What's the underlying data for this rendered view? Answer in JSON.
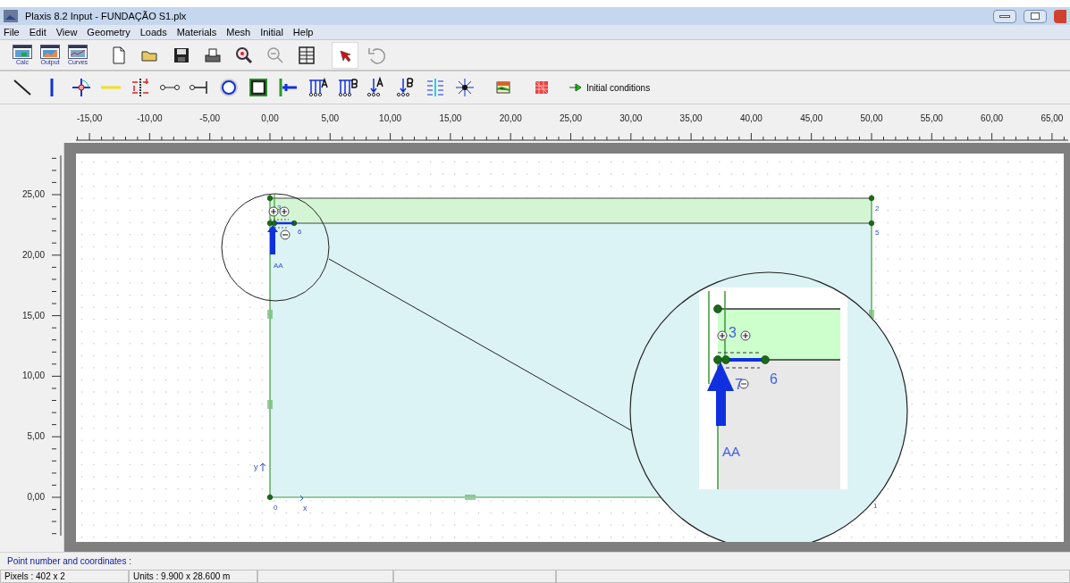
{
  "window": {
    "title": "Plaxis 8.2 Input - FUNDAÇÃO S1.plx"
  },
  "menu": [
    "File",
    "Edit",
    "View",
    "Geometry",
    "Loads",
    "Materials",
    "Mesh",
    "Initial",
    "Help"
  ],
  "programs": [
    {
      "kind": "calc",
      "label": "Calc"
    },
    {
      "kind": "output",
      "label": "Output"
    },
    {
      "kind": "curves",
      "label": "Curves"
    }
  ],
  "toolbar": [
    {
      "kind": "new",
      "selected": false
    },
    {
      "kind": "open",
      "selected": false
    },
    {
      "kind": "save",
      "selected": false
    },
    {
      "kind": "print",
      "selected": false
    },
    {
      "kind": "zoom-in",
      "selected": false
    },
    {
      "kind": "zoom-out",
      "selected": false
    },
    {
      "kind": "table",
      "selected": false
    },
    {
      "kind": "pointer",
      "selected": true
    },
    {
      "kind": "undo",
      "selected": false
    }
  ],
  "geometry_tools": [
    {
      "kind": "line",
      "selected": false
    },
    {
      "kind": "plate",
      "selected": false
    },
    {
      "kind": "hinge",
      "selected": false
    },
    {
      "kind": "geogrid",
      "selected": false
    },
    {
      "kind": "interface",
      "selected": false
    },
    {
      "kind": "anchor",
      "selected": false
    },
    {
      "kind": "fixed-anchor",
      "selected": false
    },
    {
      "kind": "tunnel",
      "selected": false
    },
    {
      "kind": "fixities",
      "selected": false
    },
    {
      "kind": "rotation",
      "selected": false
    },
    {
      "kind": "load-a",
      "selected": false
    },
    {
      "kind": "load-b",
      "selected": false
    },
    {
      "kind": "point-a",
      "selected": false
    },
    {
      "kind": "point-b",
      "selected": false
    },
    {
      "kind": "drain",
      "selected": false
    },
    {
      "kind": "well",
      "selected": false
    },
    {
      "kind": "materials",
      "selected": false
    },
    {
      "kind": "mesh",
      "selected": false
    }
  ],
  "next_step": {
    "label": "Initial conditions"
  },
  "x_ruler": {
    "labels": [
      "-15,00",
      "-10,00",
      "-5,00",
      "0,00",
      "5,00",
      "10,00",
      "15,00",
      "20,00",
      "25,00",
      "30,00",
      "35,00",
      "40,00",
      "45,00",
      "50,00",
      "55,00",
      "60,00",
      "65,00"
    ]
  },
  "y_ruler": {
    "labels": [
      "25,00",
      "20,00",
      "15,00",
      "10,00",
      "5,00",
      "0,00"
    ]
  },
  "geometry": {
    "point_labels": [
      "0",
      "1",
      "2",
      "5",
      "3",
      "6"
    ],
    "load_label": "AA",
    "axis_labels": [
      "x",
      "y"
    ]
  },
  "magnifier": {
    "point_labels": [
      "3",
      "7",
      "6"
    ],
    "load_label": "AA"
  },
  "hint": "Point number and coordinates :",
  "status_bar": [
    "Pixels : 402 x 2",
    "Units : 9.900 x 28.600 m"
  ]
}
